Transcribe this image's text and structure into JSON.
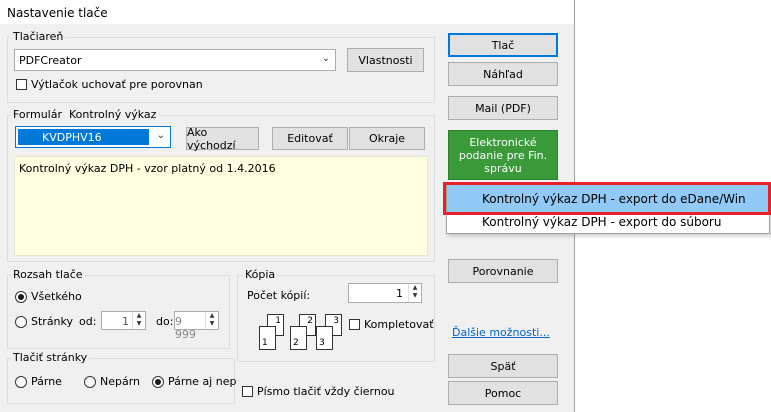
{
  "window": {
    "title": "Nastavenie tlače"
  },
  "printer": {
    "group_label": "Tlačiareň",
    "selected": "PDFCreator",
    "properties_label": "Vlastnosti",
    "keep_copy_label": "Výtlačok uchovať pre porovnan"
  },
  "form": {
    "group_label": "Formulár",
    "group_label_value": "Kontrolný výkaz",
    "selected": "KVDPHV16",
    "default_label": "Ako východzí",
    "edit_label": "Editovať",
    "margins_label": "Okraje",
    "description": "Kontrolný výkaz DPH - vzor platný od 1.4.2016"
  },
  "range": {
    "group_label": "Rozsah tlače",
    "all_label": "Všetkého",
    "pages_label": "Stránky",
    "from_label": "od:",
    "from_value": "1",
    "to_label": "do:",
    "to_value": "9 999"
  },
  "copies": {
    "group_label": "Kópia",
    "count_label": "Počet kópií:",
    "count_value": "1",
    "collate_label": "Kompletovať",
    "pages": [
      "1",
      "1",
      "2",
      "2",
      "3",
      "3"
    ]
  },
  "print_pages": {
    "group_label": "Tlačiť stránky",
    "odd_label": "Párne",
    "even_label": "Nepárn",
    "both_label": "Párne aj nep"
  },
  "black_font_label": "Písmo tlačiť vždy čiernou",
  "side": {
    "print_label": "Tlač",
    "preview_label": "Náhľad",
    "mail_label": "Mail (PDF)",
    "efiling_label": "Elektronické podanie pre Fin. správu",
    "compare_label": "Porovnanie",
    "more_label": "Ďalšie možnosti...",
    "back_label": "Späť",
    "help_label": "Pomoc"
  },
  "popup_menu": {
    "items": [
      "Kontrolný výkaz DPH - export do eDane/Win",
      "Kontrolný výkaz DPH - export do súboru"
    ]
  },
  "colors": {
    "efiling_green": "#3a9a3a",
    "highlight_red": "#e8202a",
    "selection_blue": "#0078d7",
    "description_bg": "#ffffe1"
  }
}
